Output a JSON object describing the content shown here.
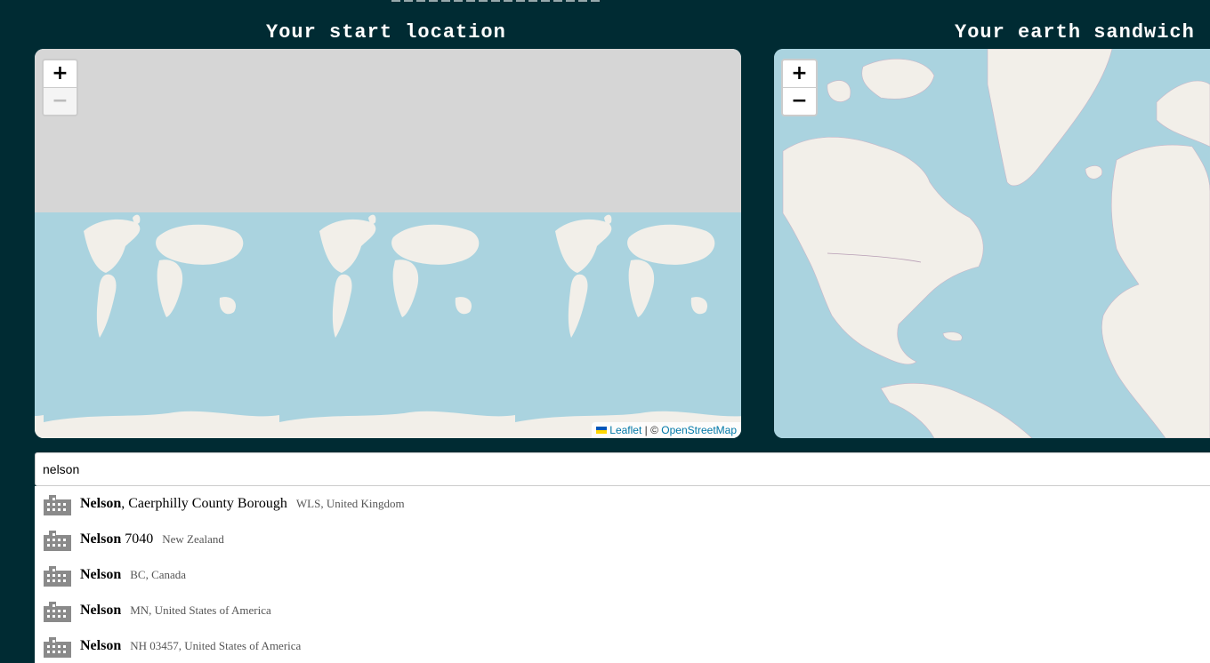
{
  "headings": {
    "start": "Your start location",
    "sandwich": "Your earth sandwich"
  },
  "map_start": {
    "zoom_in": "+",
    "zoom_out": "−",
    "attribution": {
      "leaflet": "Leaflet",
      "separator": " | © ",
      "osm": "OpenStreetMap"
    }
  },
  "map_sandwich": {
    "zoom_in": "+",
    "zoom_out": "−"
  },
  "colors": {
    "page_bg": "#002b33",
    "water": "#aad3df",
    "land": "#f2efe9",
    "empty_tile": "#d6d6d6"
  },
  "search": {
    "value": "nelson"
  },
  "results": [
    {
      "name": "Nelson",
      "suffix": ", Caerphilly County Borough",
      "region": "WLS, United Kingdom",
      "icon": "city-icon"
    },
    {
      "name": "Nelson",
      "suffix": " 7040",
      "region": "New Zealand",
      "icon": "city-icon"
    },
    {
      "name": "Nelson",
      "suffix": "",
      "region": "BC, Canada",
      "icon": "city-icon"
    },
    {
      "name": "Nelson",
      "suffix": "",
      "region": "MN, United States of America",
      "icon": "city-icon"
    },
    {
      "name": "Nelson",
      "suffix": "",
      "region": "NH 03457, United States of America",
      "icon": "city-icon"
    }
  ]
}
